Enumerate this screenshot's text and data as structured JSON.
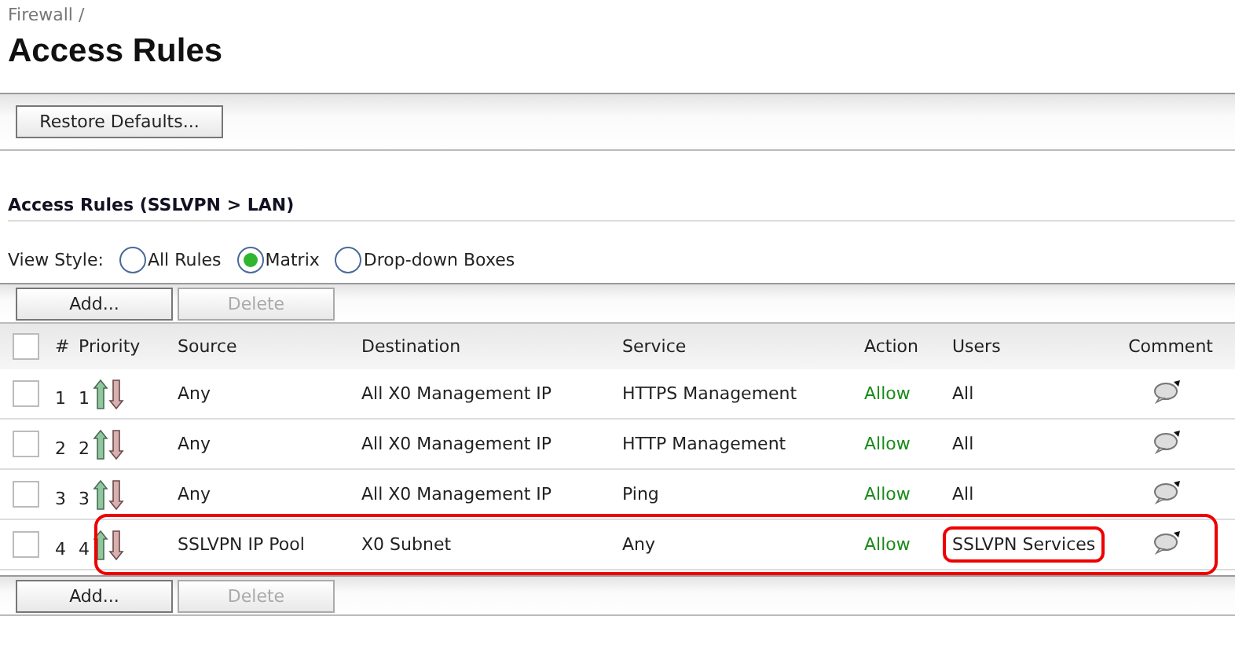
{
  "breadcrumb": "Firewall /",
  "title": "Access Rules",
  "restore_button": "Restore Defaults...",
  "section_title": "Access Rules (SSLVPN > LAN)",
  "view_style": {
    "label": "View Style:",
    "options": [
      {
        "label": "All Rules",
        "selected": false
      },
      {
        "label": "Matrix",
        "selected": true
      },
      {
        "label": "Drop-down Boxes",
        "selected": false
      }
    ]
  },
  "top_buttons": [
    {
      "label": "Add...",
      "disabled": false
    },
    {
      "label": "Delete",
      "disabled": true
    }
  ],
  "table": {
    "header_checked": false,
    "columns": [
      "#",
      "Priority",
      "Source",
      "Destination",
      "Service",
      "Action",
      "Users",
      "Comment"
    ],
    "rows": [
      {
        "checked": false,
        "number": "1",
        "priority": "1",
        "source": "Any",
        "destination": "All X0 Management IP",
        "service": "HTTPS Management",
        "action": "Allow",
        "users": "All",
        "annotated": false,
        "users_annotated": false
      },
      {
        "checked": false,
        "number": "2",
        "priority": "2",
        "source": "Any",
        "destination": "All X0 Management IP",
        "service": "HTTP Management",
        "action": "Allow",
        "users": "All",
        "annotated": false,
        "users_annotated": false
      },
      {
        "checked": false,
        "number": "3",
        "priority": "3",
        "source": "Any",
        "destination": "All X0 Management IP",
        "service": "Ping",
        "action": "Allow",
        "users": "All",
        "annotated": false,
        "users_annotated": false
      },
      {
        "checked": false,
        "number": "4",
        "priority": "4",
        "source": "SSLVPN IP Pool",
        "destination": "X0 Subnet",
        "service": "Any",
        "action": "Allow",
        "users": "SSLVPN Services",
        "annotated": true,
        "users_annotated": true
      }
    ]
  },
  "bottom_buttons": [
    {
      "label": "Add...",
      "disabled": false
    },
    {
      "label": "Delete",
      "disabled": true
    }
  ]
}
